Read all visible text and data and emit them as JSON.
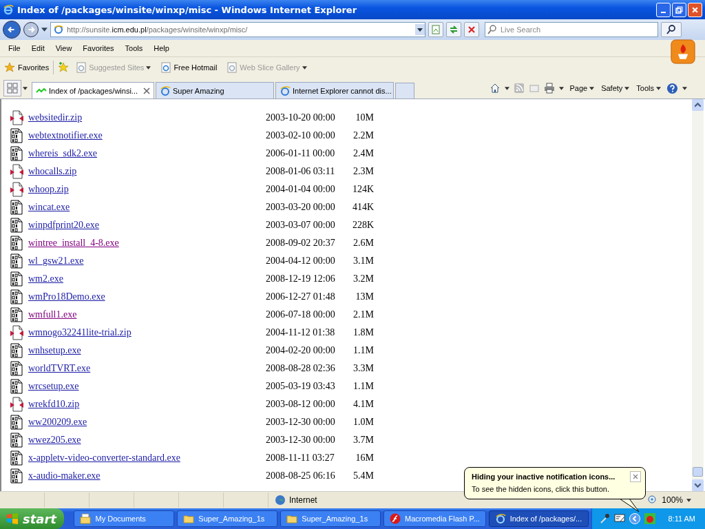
{
  "window": {
    "title": "Index of /packages/winsite/winxp/misc - Windows Internet Explorer"
  },
  "address": {
    "value_prefix": "http://sunsite.",
    "value_domain": "icm.edu.pl",
    "value_path": "/packages/winsite/winxp/misc/"
  },
  "search": {
    "placeholder": "Live Search"
  },
  "menu": [
    "File",
    "Edit",
    "View",
    "Favorites",
    "Tools",
    "Help"
  ],
  "favorites_bar": {
    "label": "Favorites",
    "items": [
      {
        "label": "Suggested Sites",
        "disabled": true
      },
      {
        "label": "Free Hotmail",
        "disabled": false
      },
      {
        "label": "Web Slice Gallery",
        "disabled": true
      }
    ]
  },
  "tabs": [
    {
      "label": "Index of /packages/winsi...",
      "selected": true
    },
    {
      "label": "Super Amazing",
      "selected": false
    },
    {
      "label": "Internet Explorer cannot dis...",
      "selected": false
    }
  ],
  "command_bar": [
    "Page",
    "Safety",
    "Tools"
  ],
  "files": [
    {
      "name": "websitedir.zip",
      "kind": "zip",
      "visited": false,
      "date": "2003-10-20 00:00",
      "size": "10M"
    },
    {
      "name": "webtextnotifier.exe",
      "kind": "exe",
      "visited": false,
      "date": "2003-02-10 00:00",
      "size": "2.2M"
    },
    {
      "name": "whereis_sdk2.exe",
      "kind": "exe",
      "visited": false,
      "date": "2006-01-11 00:00",
      "size": "2.4M"
    },
    {
      "name": "whocalls.zip",
      "kind": "zip",
      "visited": false,
      "date": "2008-01-06 03:11",
      "size": "2.3M"
    },
    {
      "name": "whoop.zip",
      "kind": "zip",
      "visited": false,
      "date": "2004-01-04 00:00",
      "size": "124K"
    },
    {
      "name": "wincat.exe",
      "kind": "exe",
      "visited": false,
      "date": "2003-03-20 00:00",
      "size": "414K"
    },
    {
      "name": "winpdfprint20.exe",
      "kind": "exe",
      "visited": false,
      "date": "2003-03-07 00:00",
      "size": "228K"
    },
    {
      "name": "wintree_install_4-8.exe",
      "kind": "exe",
      "visited": true,
      "date": "2008-09-02 20:37",
      "size": "2.6M"
    },
    {
      "name": "wl_gsw21.exe",
      "kind": "exe",
      "visited": false,
      "date": "2004-04-12 00:00",
      "size": "3.1M"
    },
    {
      "name": "wm2.exe",
      "kind": "exe",
      "visited": false,
      "date": "2008-12-19 12:06",
      "size": "3.2M"
    },
    {
      "name": "wmPro18Demo.exe",
      "kind": "exe",
      "visited": false,
      "date": "2006-12-27 01:48",
      "size": "13M"
    },
    {
      "name": "wmfull1.exe",
      "kind": "exe",
      "visited": true,
      "date": "2006-07-18 00:00",
      "size": "2.1M"
    },
    {
      "name": "wmnogo32241lite-trial.zip",
      "kind": "zip",
      "visited": false,
      "date": "2004-11-12 01:38",
      "size": "1.8M"
    },
    {
      "name": "wnhsetup.exe",
      "kind": "exe",
      "visited": false,
      "date": "2004-02-20 00:00",
      "size": "1.1M"
    },
    {
      "name": "worldTVRT.exe",
      "kind": "exe",
      "visited": false,
      "date": "2008-08-28 02:36",
      "size": "3.3M"
    },
    {
      "name": "wrcsetup.exe",
      "kind": "exe",
      "visited": false,
      "date": "2005-03-19 03:43",
      "size": "1.1M"
    },
    {
      "name": "wrekfd10.zip",
      "kind": "zip",
      "visited": false,
      "date": "2003-08-12 00:00",
      "size": "4.1M"
    },
    {
      "name": "ww200209.exe",
      "kind": "exe",
      "visited": false,
      "date": "2003-12-30 00:00",
      "size": "1.0M"
    },
    {
      "name": "wwez205.exe",
      "kind": "exe",
      "visited": false,
      "date": "2003-12-30 00:00",
      "size": "3.7M"
    },
    {
      "name": "x-appletv-video-converter-standard.exe",
      "kind": "exe",
      "visited": false,
      "date": "2008-11-11 03:27",
      "size": "16M"
    },
    {
      "name": "x-audio-maker.exe",
      "kind": "exe",
      "visited": false,
      "date": "2008-08-25 06:16",
      "size": "5.4M"
    }
  ],
  "status_bar": {
    "zone": "Internet",
    "zoom": "100%"
  },
  "balloon": {
    "title": "Hiding your inactive notification icons...",
    "text": "To see the hidden icons, click this button."
  },
  "taskbar": {
    "start": "start",
    "items": [
      {
        "label": "My Documents",
        "kind": "documents",
        "selected": false
      },
      {
        "label": "Super_Amazing_1s",
        "kind": "folder",
        "selected": false
      },
      {
        "label": "Super_Amazing_1s",
        "kind": "folder",
        "selected": false
      },
      {
        "label": "Macromedia Flash P...",
        "kind": "flash",
        "selected": false
      },
      {
        "label": "Index of /packages/...",
        "kind": "browser",
        "selected": true
      }
    ],
    "clock": "8:11 AM"
  }
}
